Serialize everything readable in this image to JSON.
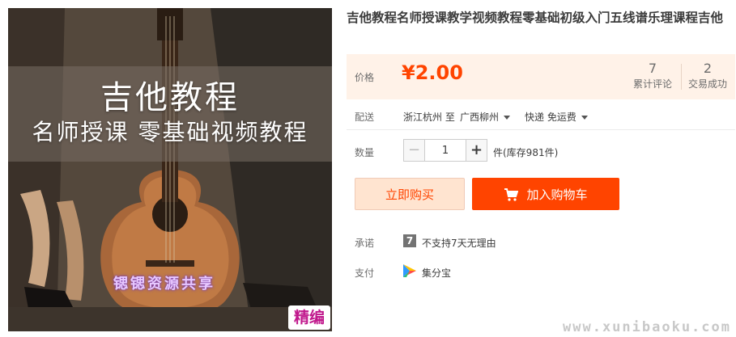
{
  "image": {
    "title_big": "吉他教程",
    "title_small": "名师授课   零基础视频教程",
    "watermark": "锶锶资源共享",
    "badge": "精编"
  },
  "product": {
    "title": "吉他教程名师授课教学视频教程零基础初级入门五线谱乐理课程吉他"
  },
  "price": {
    "label": "价格",
    "value": "¥2.00",
    "accent_color": "#ff4400",
    "reviews_count": "7",
    "reviews_label": "累计评论",
    "deals_count": "2",
    "deals_label": "交易成功"
  },
  "delivery": {
    "label": "配送",
    "from": "浙江杭州 至",
    "to": "广西柳州",
    "shipping": "快递 免运费"
  },
  "quantity": {
    "label": "数量",
    "value": "1",
    "minus": "−",
    "plus": "+",
    "unit": "件(库存981件)"
  },
  "actions": {
    "buy_now": "立即购买",
    "add_to_cart": "加入购物车"
  },
  "promise": {
    "label": "承诺",
    "icon_text": "7",
    "text": "不支持7天无理由"
  },
  "payment": {
    "label": "支付",
    "text": "集分宝"
  },
  "footer": {
    "site_watermark": "www.xunibaoku.com"
  }
}
